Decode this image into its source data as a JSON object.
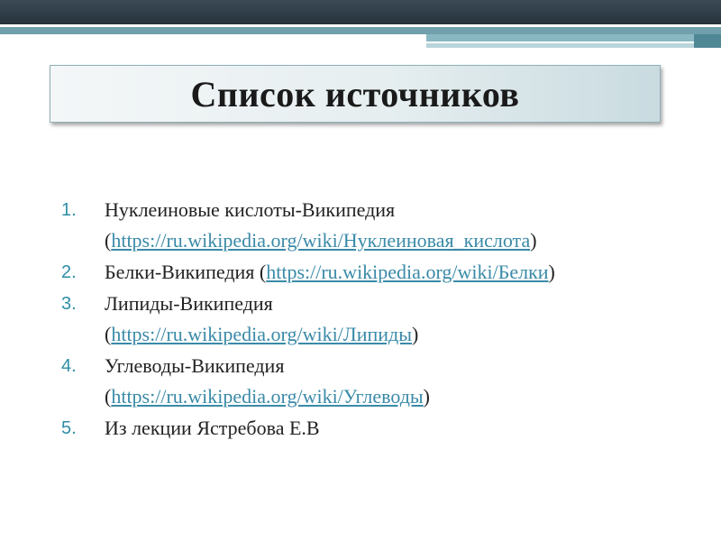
{
  "title": "Список источников",
  "colors": {
    "accent": "#2f8ea6",
    "link": "#3a8aa8",
    "header_dark": "#2f3b45",
    "header_teal": "#6fa0ac"
  },
  "sources": [
    {
      "number": "1.",
      "text_before": "Нуклеиновые кислоты-Википедия",
      "text_open": "(",
      "link": "https://ru.wikipedia.org/wiki/Нуклеиновая_кислота",
      "text_close": ")"
    },
    {
      "number": "2.",
      "text_before": "Белки-Википедия (",
      "link": "https://ru.wikipedia.org/wiki/Белки",
      "text_close": ")"
    },
    {
      "number": "3.",
      "text_before": "Липиды-Википедия",
      "text_open": "(",
      "link": "https://ru.wikipedia.org/wiki/Липиды",
      "text_close": ")"
    },
    {
      "number": "4.",
      "text_before": "Углеводы-Википедия",
      "text_open": "(",
      "link": "https://ru.wikipedia.org/wiki/Углеводы",
      "text_close": ")"
    },
    {
      "number": "5.",
      "text": "Из лекции Ястребова Е.В"
    }
  ]
}
